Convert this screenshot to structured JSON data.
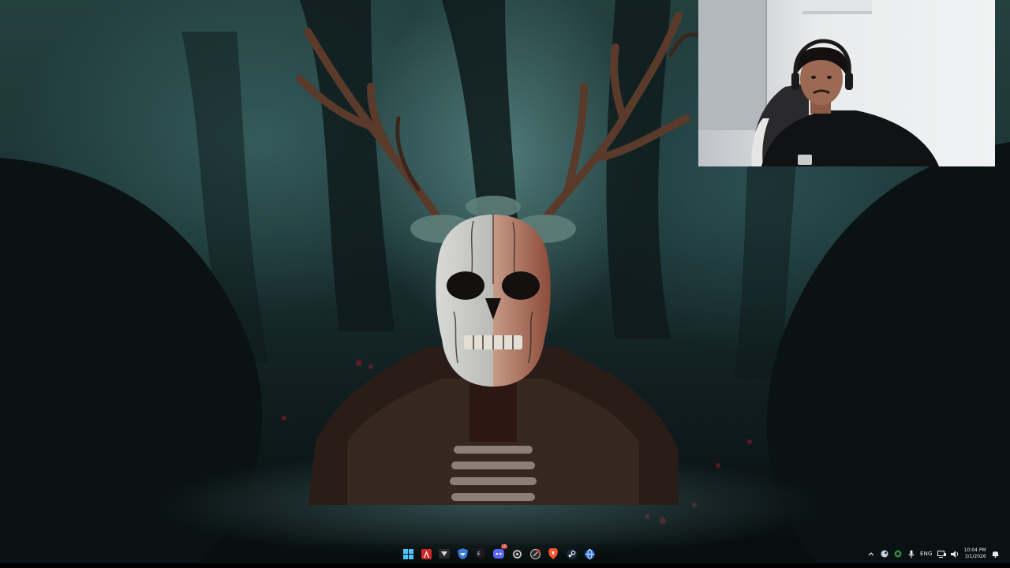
{
  "desktop": {
    "wallpaper": "dark-forest-antlered-skull-creature",
    "accent": "#2f5556"
  },
  "webcam": {
    "subject": "streamer-with-headphones"
  },
  "taskbar": {
    "apps": [
      {
        "name": "start-icon",
        "color": "#4cc2ff"
      },
      {
        "name": "adobe-acrobat-icon",
        "color": "#d2232a"
      },
      {
        "name": "media-player-icon",
        "color": "#2a2a2a"
      },
      {
        "name": "shield-app-icon",
        "color": "#3a7bd5"
      },
      {
        "name": "epic-games-icon",
        "color": "#1a1a1a"
      },
      {
        "name": "discord-icon",
        "color": "#5865f2",
        "badge": "10"
      },
      {
        "name": "obs-icon",
        "color": "#1f1f1f"
      },
      {
        "name": "circle-app-icon",
        "color": "#2b2b2b"
      },
      {
        "name": "brave-browser-icon",
        "color": "#fb542b"
      },
      {
        "name": "steam-icon",
        "color": "#1b2838"
      },
      {
        "name": "globe-app-icon",
        "color": "#2f6fd6"
      }
    ],
    "tray": {
      "language": "ENG",
      "time": "10:04 PM",
      "date": "3/1/2026"
    }
  }
}
